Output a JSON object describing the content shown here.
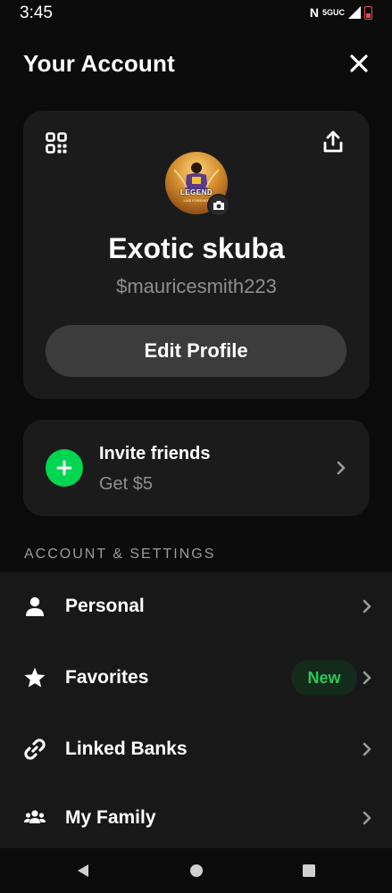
{
  "status_bar": {
    "time": "3:45",
    "network": "5GUC"
  },
  "header": {
    "title": "Your Account"
  },
  "profile": {
    "avatar_text": "LEGEND",
    "avatar_subtext": "LIVE FOREVER",
    "display_name": "Exotic skuba",
    "cashtag": "$mauricesmith223",
    "edit_button_label": "Edit Profile"
  },
  "invite": {
    "title": "Invite friends",
    "subtitle": "Get $5"
  },
  "section": {
    "title": "ACCOUNT & SETTINGS"
  },
  "settings": {
    "items": [
      {
        "label": "Personal",
        "icon": "person-icon"
      },
      {
        "label": "Favorites",
        "icon": "star-icon",
        "badge": "New"
      },
      {
        "label": "Linked Banks",
        "icon": "link-icon"
      },
      {
        "label": "My Family",
        "icon": "family-icon"
      }
    ]
  },
  "colors": {
    "background": "#0b0b0b",
    "card": "#1b1b1b",
    "accent_green": "#00d64f",
    "muted_text": "#8e8e8e"
  }
}
